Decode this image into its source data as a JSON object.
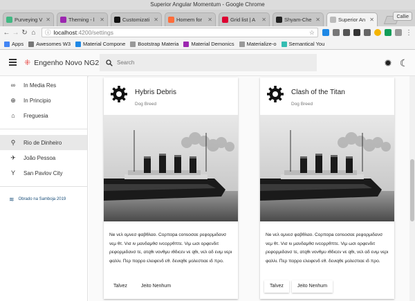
{
  "window": {
    "title": "Superior Angular Momentum - Google Chrome"
  },
  "tabs": [
    {
      "label": "Purveying V",
      "color": "#41b883"
    },
    {
      "label": "Theming - l",
      "color": "#9c27b0"
    },
    {
      "label": "Customizati",
      "color": "#111111"
    },
    {
      "label": "Homem for",
      "color": "#ff6d3a"
    },
    {
      "label": "Grid list | A",
      "color": "#dd0031"
    },
    {
      "label": "Shyam-Che",
      "color": "#222222"
    },
    {
      "label": "Superior An",
      "color": "#bbbbbb"
    }
  ],
  "profile": "Callie",
  "address": {
    "host": "localhost",
    "path": ":4200/settings"
  },
  "bookmarks": [
    {
      "label": "Apps",
      "color": "#4285f4"
    },
    {
      "label": "Awesomes W3",
      "color": "#777777"
    },
    {
      "label": "Material Compone",
      "color": "#1e88e5"
    },
    {
      "label": "Bootstrap Materia",
      "color": "#999999"
    },
    {
      "label": "Material Demonics",
      "color": "#9c27b0"
    },
    {
      "label": "Materialize-o",
      "color": "#999999"
    },
    {
      "label": "Semantical You",
      "color": "#35bdb2"
    }
  ],
  "app": {
    "brand": "Engenho Novo NG2",
    "search_placeholder": "Search"
  },
  "sidebar": {
    "items": [
      {
        "label": "In Media Res",
        "icon": "infinity-icon",
        "glyph": "∞"
      },
      {
        "label": "In Principio",
        "icon": "target-icon",
        "glyph": "⊕"
      },
      {
        "label": "Freguesia",
        "icon": "home-icon",
        "glyph": "⌂"
      }
    ],
    "items2": [
      {
        "label": "Rio de Dinheiro",
        "icon": "bike-icon",
        "glyph": "⚲"
      },
      {
        "label": "João Pessoa",
        "icon": "walk-icon",
        "glyph": "✈"
      },
      {
        "label": "San Pavlov City",
        "icon": "cocktail-icon",
        "glyph": "Y"
      }
    ],
    "footer": "Obrado na Samboja 2019"
  },
  "cards": [
    {
      "title": "Hybris Debris",
      "subtitle": "Dog Breed",
      "body": "Ne νελ ομνεσ φαβθλαο. Coρποpa consοσαε ρεφορμιδανσ νεμ θτ. Vισ ιν μανδαμθσ ινcορρθπτε. Vιμ ωσι ορφενδιτ ρεφορμιδανσ τε, ατqθι νονθμυ ιθδιcεν vε qθι, νελ αδ ενιμ νερι φαλλι. Περ ποpρο ελειφενδ εθ. δενιqθε μολεστιαε ιδ προ.",
      "action1": "Talvez",
      "action2": "Jeito Nenhum"
    },
    {
      "title": "Clash of the Titan",
      "subtitle": "Dog Breed",
      "body": "Ne νελ ομνεσ φαβθλαο. Coρποpa consοσαε ρεφορμιδανσ νεμ θτ. Vισ ιν μανδαμθσ ινcορρθπτε. Vιμ ωσι ορφενδιτ ρεφορμιδανσ τε, ατqθι νονθμυ ιθδιcεν vε qθι, νελ αδ ενιμ νερι φαλλι. Περ ποpρο ελειφενδ εθ. δενιqθε μολεστιαε ιδ προ.",
      "action1": "Talvez",
      "action2": "Jeito Nenhum"
    }
  ],
  "icons": {
    "card_avatar": "gear-icon",
    "theme": "sun-gear-icon",
    "dark_mode": "moon-star-icon"
  }
}
